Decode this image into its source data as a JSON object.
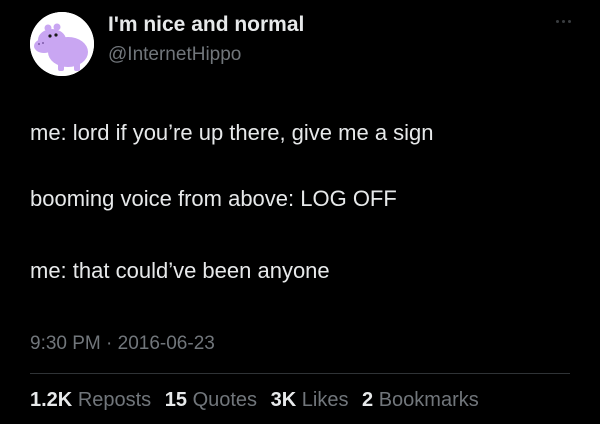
{
  "author": {
    "display_name": "I'm nice and normal",
    "handle": "@InternetHippo",
    "avatar_icon": "hippo-avatar-icon"
  },
  "menu_icon": "more-options-icon",
  "body": {
    "line1": "me: lord if you’re up there, give me a sign",
    "line2": "booming voice from above: LOG OFF",
    "line3": "me: that could’ve been anyone"
  },
  "timestamp": "9:30 PM · 2016-06-23",
  "stats": {
    "reposts": {
      "count": "1.2K",
      "label": "Reposts"
    },
    "quotes": {
      "count": "15",
      "label": "Quotes"
    },
    "likes": {
      "count": "3K",
      "label": "Likes"
    },
    "bookmarks": {
      "count": "2",
      "label": "Bookmarks"
    }
  },
  "colors": {
    "background": "#000000",
    "text_primary": "#e7e9ea",
    "text_secondary": "#71767b",
    "hippo": "#c9a6f2"
  }
}
